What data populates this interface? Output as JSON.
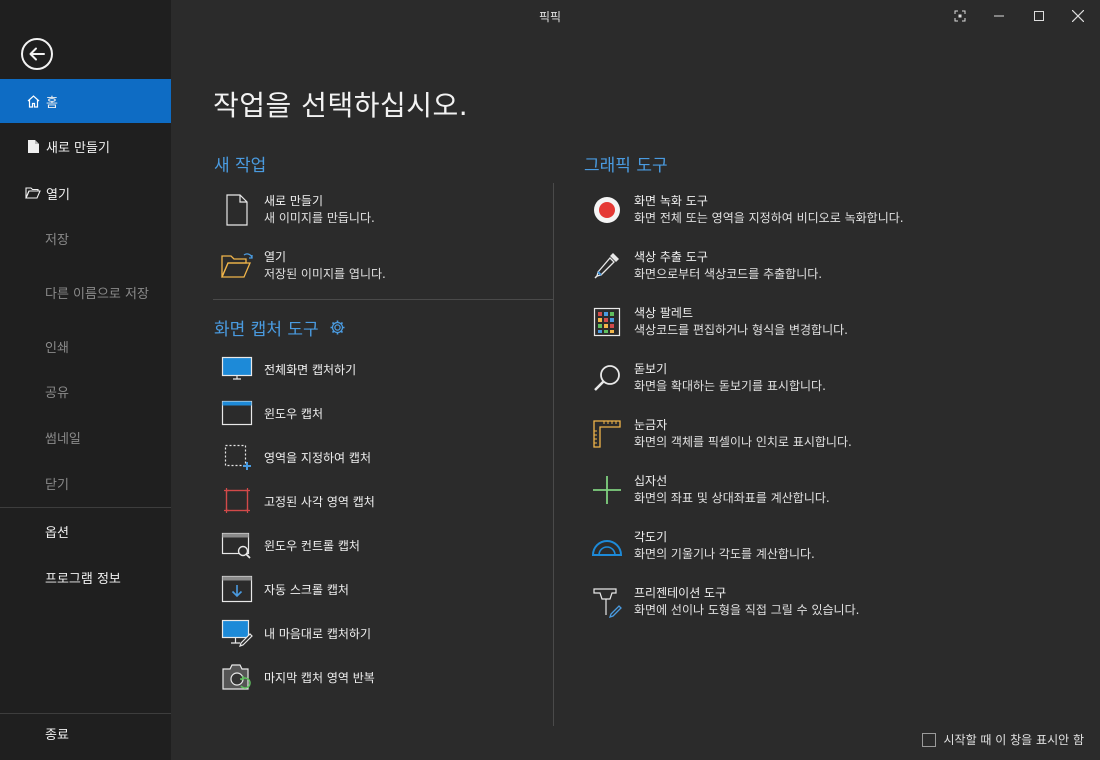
{
  "window": {
    "title": "픽픽"
  },
  "sidebar": {
    "items": [
      {
        "label": "홈",
        "icon": "home-icon",
        "state": "active"
      },
      {
        "label": "새로 만들기",
        "icon": "new-file-icon",
        "state": "normal"
      },
      {
        "label": "열기",
        "icon": "folder-open-icon",
        "state": "normal"
      },
      {
        "label": "저장",
        "state": "disabled"
      },
      {
        "label": "다른 이름으로 저장",
        "state": "disabled"
      },
      {
        "label": "인쇄",
        "state": "disabled"
      },
      {
        "label": "공유",
        "state": "disabled"
      },
      {
        "label": "썸네일",
        "state": "disabled"
      },
      {
        "label": "닫기",
        "state": "disabled"
      },
      {
        "label": "옵션",
        "state": "normal"
      },
      {
        "label": "프로그램 정보",
        "state": "normal"
      },
      {
        "label": "종료",
        "state": "normal"
      }
    ]
  },
  "main": {
    "heading": "작업을 선택하십시오.",
    "new_task": {
      "title": "새 작업",
      "items": [
        {
          "title": "새로 만들기",
          "desc": "새 이미지를 만듭니다."
        },
        {
          "title": "열기",
          "desc": "저장된 이미지를 엽니다."
        }
      ]
    },
    "capture": {
      "title": "화면 캡처 도구",
      "items": [
        {
          "label": "전체화면 캡처하기"
        },
        {
          "label": "윈도우 캡처"
        },
        {
          "label": "영역을 지정하여 캡처"
        },
        {
          "label": "고정된 사각 영역 캡처"
        },
        {
          "label": "윈도우 컨트롤 캡처"
        },
        {
          "label": "자동 스크롤 캡처"
        },
        {
          "label": "내 마음대로 캡처하기"
        },
        {
          "label": "마지막 캡처 영역 반복"
        }
      ]
    },
    "graphic": {
      "title": "그래픽 도구",
      "items": [
        {
          "title": "화면 녹화 도구",
          "desc": "화면 전체 또는 영역을 지정하여 비디오로 녹화합니다."
        },
        {
          "title": "색상 추출 도구",
          "desc": "화면으로부터 색상코드를 추출합니다."
        },
        {
          "title": "색상 팔레트",
          "desc": "색상코드를 편집하거나 형식을 변경합니다."
        },
        {
          "title": "돋보기",
          "desc": "화면을 확대하는 돋보기를 표시합니다."
        },
        {
          "title": "눈금자",
          "desc": "화면의 객체를 픽셀이나 인치로 표시합니다."
        },
        {
          "title": "십자선",
          "desc": "화면의 좌표 및 상대좌표를 계산합니다."
        },
        {
          "title": "각도기",
          "desc": "화면의 기울기나 각도를 계산합니다."
        },
        {
          "title": "프리젠테이션 도구",
          "desc": "화면에 선이나 도형을 직접 그릴 수 있습니다."
        }
      ]
    }
  },
  "footer": {
    "dont_show_label": "시작할 때 이 창을 표시안 함"
  },
  "colors": {
    "accent": "#0e6cc4",
    "section_title": "#4a9be0",
    "sidebar_bg": "#1f1f1f",
    "main_bg": "#2b2b2b"
  }
}
